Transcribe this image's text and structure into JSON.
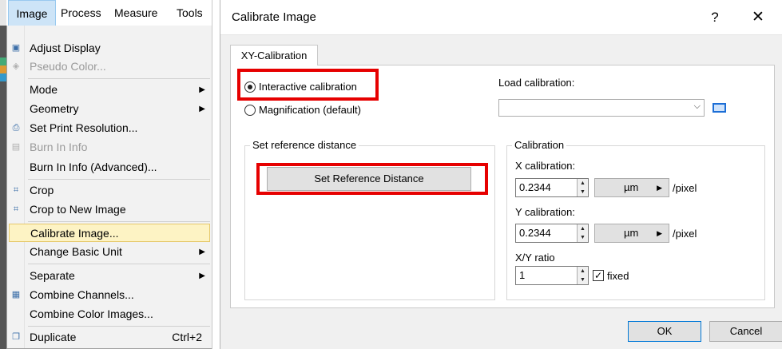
{
  "menubar": {
    "items": [
      "Image",
      "Process",
      "Measure",
      "Tools"
    ]
  },
  "image_menu": {
    "items": [
      {
        "label": "Adjust Display",
        "icon": "display-icon"
      },
      {
        "label": "Pseudo Color...",
        "icon": "palette-icon",
        "disabled": true
      },
      {
        "label": "Mode",
        "submenu": true
      },
      {
        "label": "Geometry",
        "submenu": true
      },
      {
        "label": "Set Print Resolution...",
        "icon": "print-icon"
      },
      {
        "label": "Burn In Info",
        "icon": "info-icon",
        "disabled": true
      },
      {
        "label": "Burn In Info (Advanced)..."
      },
      {
        "label": "Crop",
        "icon": "crop-icon"
      },
      {
        "label": "Crop to New Image",
        "icon": "crop-new-icon"
      },
      {
        "label": "Calibrate Image...",
        "highlighted": true
      },
      {
        "label": "Change Basic Unit",
        "submenu": true
      },
      {
        "label": "Separate",
        "submenu": true
      },
      {
        "label": "Combine Channels...",
        "icon": "combine-icon"
      },
      {
        "label": "Combine Color Images..."
      },
      {
        "label": "Duplicate",
        "icon": "duplicate-icon",
        "shortcut": "Ctrl+2"
      }
    ]
  },
  "dialog": {
    "title": "Calibrate Image",
    "help_glyph": "?",
    "close_glyph": "✕",
    "tab": "XY-Calibration",
    "mode": {
      "interactive_label": "Interactive calibration",
      "magnification_label": "Magnification (default)",
      "selected": "interactive"
    },
    "load_calibration": {
      "label": "Load calibration:",
      "value": ""
    },
    "reference": {
      "group_title": "Set reference distance",
      "button_label": "Set Reference Distance"
    },
    "calibration": {
      "group_title": "Calibration",
      "x_label": "X calibration:",
      "x_value": "0.2344",
      "x_unit": "µm",
      "y_label": "Y calibration:",
      "y_value": "0.2344",
      "y_unit": "µm",
      "per_pixel": "/pixel",
      "ratio_label": "X/Y ratio",
      "ratio_value": "1",
      "fixed_label": "fixed",
      "fixed_checked": true
    },
    "ok_label": "OK",
    "cancel_label": "Cancel"
  },
  "colors": {
    "highlight_red": "#e60000",
    "menu_highlight": "#fdf3c4",
    "accent_blue": "#0078d7"
  }
}
